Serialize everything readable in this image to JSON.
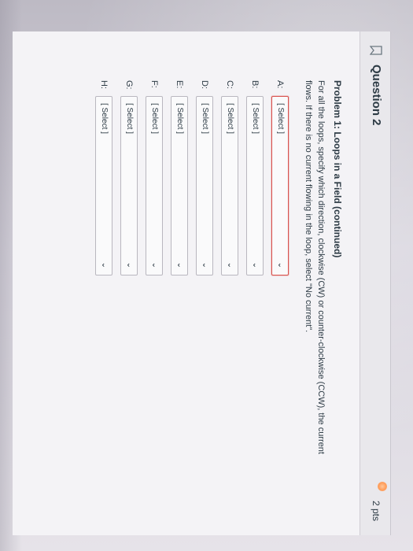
{
  "question": {
    "title": "Question 2",
    "points": "2 pts"
  },
  "problem": {
    "title": "Problem 1: Loops in a Field (continued)",
    "instructions": "For all the loops, specify which direction, clockwise (CW) or counter-clockwise (CCW), the current flows. If there is no current flowing in the loop, select \"No current\"."
  },
  "rows": [
    {
      "label": "A:",
      "value": "[ Select ]",
      "active": true
    },
    {
      "label": "B:",
      "value": "[ Select ]",
      "active": false
    },
    {
      "label": "C:",
      "value": "[ Select ]",
      "active": false
    },
    {
      "label": "D:",
      "value": "[ Select ]",
      "active": false
    },
    {
      "label": "E:",
      "value": "[ Select ]",
      "active": false
    },
    {
      "label": "F:",
      "value": "[ Select ]",
      "active": false
    },
    {
      "label": "G:",
      "value": "[ Select ]",
      "active": false
    },
    {
      "label": "H:",
      "value": "[ Select ]",
      "active": false
    }
  ],
  "icons": {
    "flag": "flag-icon",
    "dropdown": "chevron-down-icon"
  },
  "colors": {
    "text": "#2d3b45",
    "active_border": "#d9534f",
    "orange_light": "#ff9a55"
  }
}
